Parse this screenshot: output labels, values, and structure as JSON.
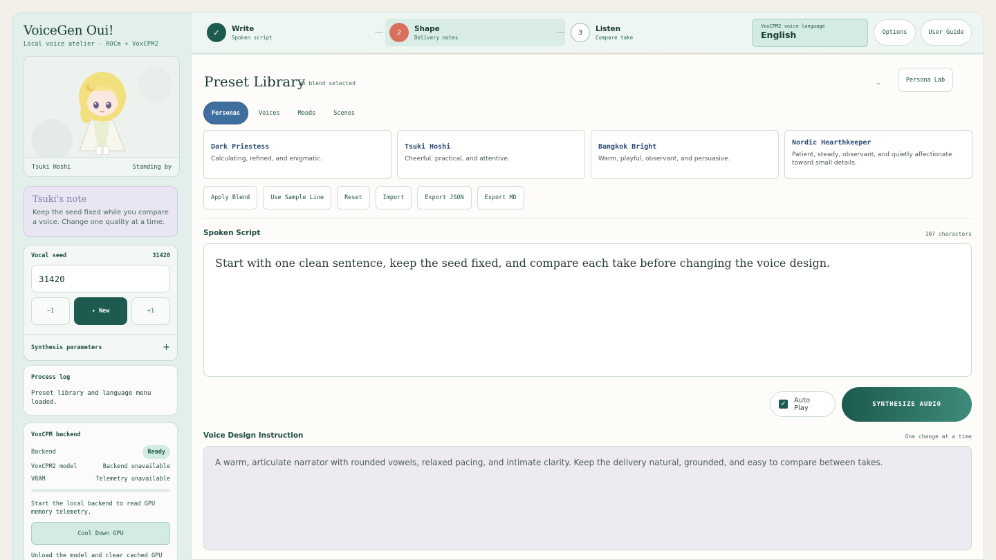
{
  "brand": {
    "title": "VoiceGen Oui!",
    "subtitle": "Local voice atelier · ROCm + VoxCPM2"
  },
  "avatar": {
    "name": "Tsuki Hoshi",
    "status": "Standing by"
  },
  "note": {
    "title": "Tsuki's note",
    "body": "Keep the seed fixed while you compare a voice. Change one quality at a time."
  },
  "seed": {
    "label": "Vocal seed",
    "value_display": "31420",
    "input_value": "31420",
    "minus_label": "−1",
    "new_label": "✦ New",
    "plus_label": "+1"
  },
  "synthesis": {
    "label": "Synthesis parameters",
    "toggle": "+"
  },
  "process_log": {
    "label": "Process log",
    "body": "Preset library and language menu loaded."
  },
  "backend": {
    "label": "VoxCPM backend",
    "backend_key": "Backend",
    "backend_status": "Ready",
    "model_key": "VoxCPM2 model",
    "model_value": "Backend unavailable",
    "vram_key": "VRAM",
    "vram_value": "Telemetry unavailable",
    "hint": "Start the local backend to read GPU memory telemetry.",
    "cool_down_label": "Cool Down GPU",
    "footer": "Unload the model and clear cached GPU"
  },
  "steps": [
    {
      "num": "✓",
      "title": "Write",
      "sub": "Spoken script"
    },
    {
      "num": "2",
      "title": "Shape",
      "sub": "Delivery notes"
    },
    {
      "num": "3",
      "title": "Listen",
      "sub": "Compare take"
    }
  ],
  "language": {
    "label": "VoxCPM2 voice language",
    "value": "English"
  },
  "header_buttons": {
    "options": "Options",
    "user_guide": "User Guide"
  },
  "library": {
    "title": "Preset Library",
    "subtitle": "No blend selected",
    "dash": "–",
    "persona_lab": "Persona Lab",
    "tabs": [
      "Personas",
      "Voices",
      "Moods",
      "Scenes"
    ],
    "cards": [
      {
        "name": "Dark Priestess",
        "desc": "Calculating, refined, and enigmatic."
      },
      {
        "name": "Tsuki Hoshi",
        "desc": "Cheerful, practical, and attentive."
      },
      {
        "name": "Bangkok Bright",
        "desc": "Warm, playful, observant, and persuasive."
      },
      {
        "name": "Nordic Hearthkeeper",
        "desc": "Patient, steady, observant, and quietly affectionate toward small details."
      }
    ],
    "actions": [
      "Apply Blend",
      "Use Sample Line",
      "Reset",
      "Import",
      "Export JSON",
      "Export MD"
    ]
  },
  "script": {
    "label": "Spoken Script",
    "count": "107 characters",
    "text": "Start with one clean sentence, keep the seed fixed, and compare each take before changing the voice design."
  },
  "controls": {
    "autoplay": "Auto Play",
    "synthesize": "SYNTHESIZE AUDIO"
  },
  "design": {
    "label": "Voice Design Instruction",
    "hint": "One change at a time",
    "text": "A warm, articulate narrator with rounded vowels, relaxed pacing, and intimate clarity. Keep the delivery natural, grounded, and easy to compare between takes."
  },
  "colors": {
    "accent": "#1d5a4f",
    "tab_active": "#3f6f9f",
    "step_current": "#d9705e",
    "note_bg": "#e9e5f2"
  }
}
